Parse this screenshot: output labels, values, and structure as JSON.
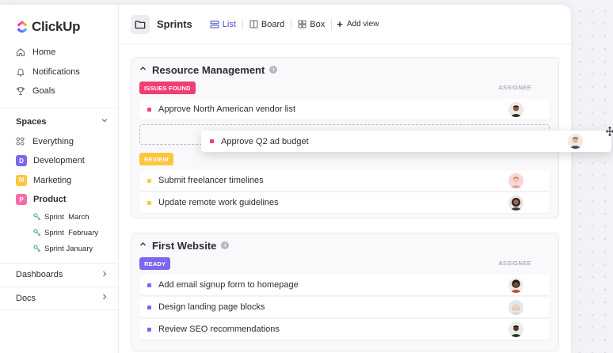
{
  "brand": {
    "name": "ClickUp"
  },
  "nav": [
    {
      "label": "Home",
      "icon": "home-icon"
    },
    {
      "label": "Notifications",
      "icon": "bell-icon"
    },
    {
      "label": "Goals",
      "icon": "trophy-icon"
    }
  ],
  "spaces": {
    "heading": "Spaces",
    "everything": "Everything",
    "items": [
      {
        "letter": "D",
        "label": "Development",
        "color": "#7b68ee"
      },
      {
        "letter": "M",
        "label": "Marketing",
        "color": "#ffc53d"
      },
      {
        "letter": "P",
        "label": "Product",
        "color": "#f56ca8"
      }
    ],
    "sprints": [
      "Sprint  March",
      "Sprint  February",
      "Sprint January"
    ]
  },
  "sidebar_links": [
    {
      "label": "Dashboards"
    },
    {
      "label": "Docs"
    }
  ],
  "topbar": {
    "title": "Sprints",
    "views": [
      {
        "label": "List",
        "active": true
      },
      {
        "label": "Board",
        "active": false
      },
      {
        "label": "Box",
        "active": false
      }
    ],
    "add_view": "Add view"
  },
  "groups": [
    {
      "title": "Resource Management",
      "statuses": [
        {
          "label": "ISSUES FOUND",
          "color": "#f03e72",
          "assignee_header": "ASSIGNEE",
          "tasks": [
            {
              "name": "Approve North American vendor list",
              "dot": "#f03e72"
            }
          ]
        },
        {
          "label": "REVIEW",
          "color": "#ffc53d",
          "tasks": [
            {
              "name": "Submit freelancer timelines",
              "dot": "#ffc53d"
            },
            {
              "name": "Update remote work guidelines",
              "dot": "#ffc53d"
            }
          ]
        }
      ]
    },
    {
      "title": "First Website",
      "statuses": [
        {
          "label": "READY",
          "color": "#7b68ee",
          "assignee_header": "ASSIGNEE",
          "tasks": [
            {
              "name": "Add email signup form to homepage",
              "dot": "#7b68ee"
            },
            {
              "name": "Design landing page blocks",
              "dot": "#7b68ee"
            },
            {
              "name": "Review SEO recommendations",
              "dot": "#7b68ee"
            }
          ]
        }
      ]
    }
  ],
  "dragging_task": {
    "name": "Approve Q2 ad budget",
    "dot": "#f03e72"
  }
}
